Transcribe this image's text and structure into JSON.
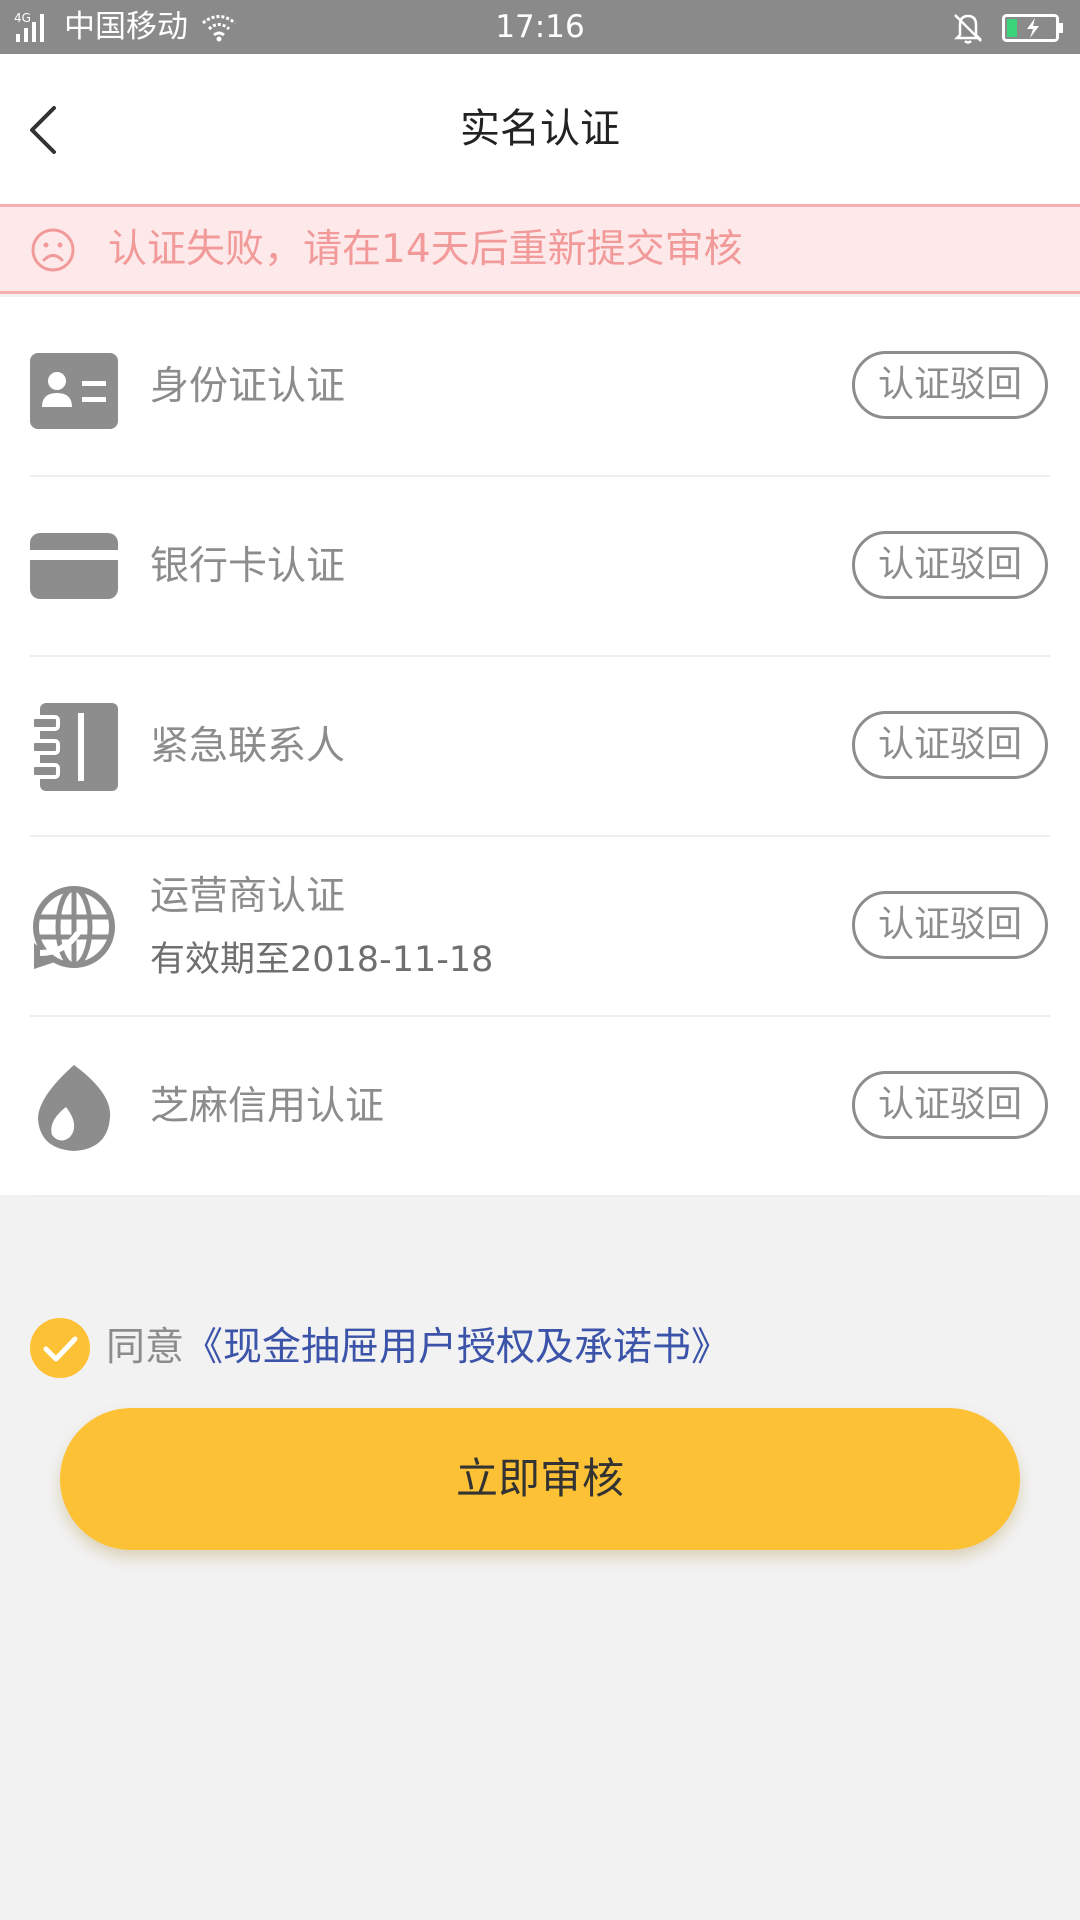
{
  "status_bar": {
    "network": "4G",
    "carrier": "中国移动",
    "time": "17:16",
    "battery_color": "#3bd47a"
  },
  "header": {
    "title": "实名认证",
    "back_icon": "chevron-left-icon"
  },
  "alert": {
    "icon": "sad-face-icon",
    "message": "认证失败，请在14天后重新提交审核",
    "color": "#f29a9a",
    "background": "#fde9e9"
  },
  "items": [
    {
      "icon": "id-card-icon",
      "label": "身份证认证",
      "sub": "",
      "status": "认证驳回"
    },
    {
      "icon": "bank-card-icon",
      "label": "银行卡认证",
      "sub": "",
      "status": "认证驳回"
    },
    {
      "icon": "contact-book-icon",
      "label": "紧急联系人",
      "sub": "",
      "status": "认证驳回"
    },
    {
      "icon": "globe-arrow-icon",
      "label": "运营商认证",
      "sub": "有效期至2018-11-18",
      "status": "认证驳回"
    },
    {
      "icon": "sesame-drop-icon",
      "label": "芝麻信用认证",
      "sub": "",
      "status": "认证驳回"
    }
  ],
  "agreement": {
    "checked": true,
    "prefix": "同意",
    "link": "《现金抽屉用户授权及承诺书》",
    "link_color": "#3b53a8"
  },
  "submit": {
    "label": "立即审核",
    "color": "#fcc135"
  }
}
